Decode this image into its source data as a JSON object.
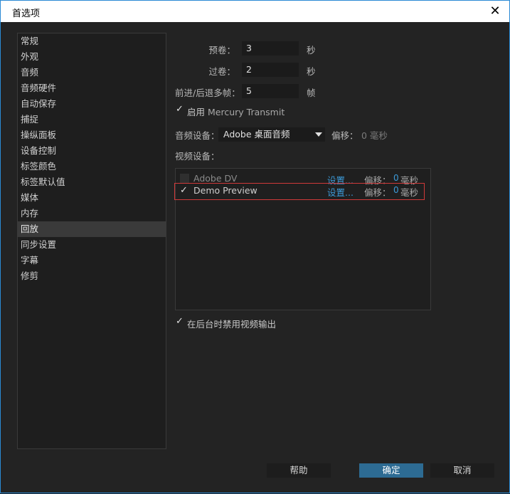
{
  "window": {
    "title": "首选项"
  },
  "sidebar": {
    "items": [
      {
        "label": "常规"
      },
      {
        "label": "外观"
      },
      {
        "label": "音频"
      },
      {
        "label": "音频硬件"
      },
      {
        "label": "自动保存"
      },
      {
        "label": "捕捉"
      },
      {
        "label": "操纵面板"
      },
      {
        "label": "设备控制"
      },
      {
        "label": "标签颜色"
      },
      {
        "label": "标签默认值"
      },
      {
        "label": "媒体"
      },
      {
        "label": "内存"
      },
      {
        "label": "回放"
      },
      {
        "label": "同步设置"
      },
      {
        "label": "字幕"
      },
      {
        "label": "修剪"
      }
    ],
    "selected_index": 12
  },
  "playback": {
    "preroll": {
      "label": "预卷：",
      "value": "3",
      "unit": "秒"
    },
    "postroll": {
      "label": "过卷：",
      "value": "2",
      "unit": "秒"
    },
    "step": {
      "label": "前进/后退多帧：",
      "value": "5",
      "unit": "帧"
    },
    "mercury": {
      "checked": true,
      "label_prefix": "启用",
      "label_rest": "Mercury Transmit"
    },
    "audio_device": {
      "label": "音频设备：",
      "selected": "Adobe 桌面音频",
      "offset_label": "偏移：",
      "offset_value": "0 毫秒"
    },
    "video_device_label": "视频设备：",
    "devices": [
      {
        "name": "Adobe DV",
        "checked": false,
        "settings": "设置...",
        "offset_label": "偏移：",
        "offset_value": "0",
        "offset_unit": "毫秒"
      },
      {
        "name": "Demo Preview",
        "checked": true,
        "settings": "设置...",
        "offset_label": "偏移：",
        "offset_value": "0",
        "offset_unit": "毫秒"
      }
    ],
    "disable_bg": {
      "checked": true,
      "label": "在后台时禁用视频输出"
    }
  },
  "buttons": {
    "help": "帮助",
    "ok": "确定",
    "cancel": "取消"
  },
  "colors": {
    "accent": "#2a8ad4",
    "link": "#3c9ad8",
    "highlight_border": "#d03a3a",
    "primary_button": "#2d6b93"
  }
}
